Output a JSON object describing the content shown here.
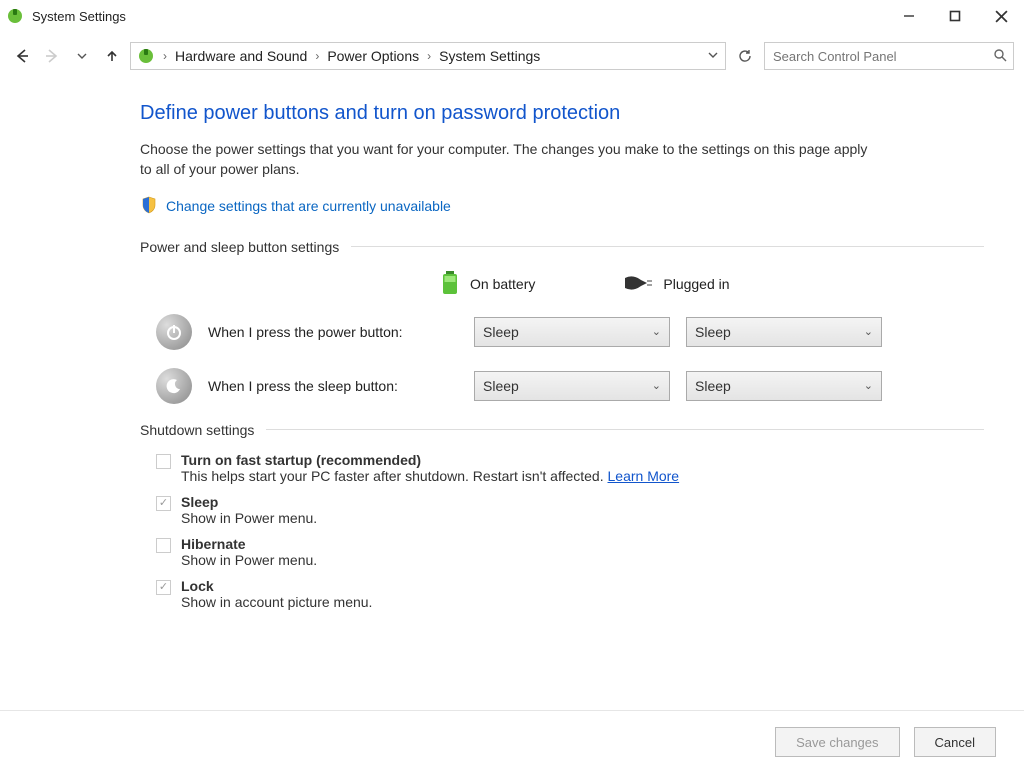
{
  "window": {
    "title": "System Settings"
  },
  "breadcrumb": {
    "item1": "Hardware and Sound",
    "item2": "Power Options",
    "item3": "System Settings"
  },
  "search": {
    "placeholder": "Search Control Panel"
  },
  "page": {
    "headline": "Define power buttons and turn on password protection",
    "desc": "Choose the power settings that you want for your computer. The changes you make to the settings on this page apply to all of your power plans.",
    "change_unavailable": "Change settings that are currently unavailable"
  },
  "group1": {
    "label": "Power and sleep button settings",
    "col_battery": "On battery",
    "col_plugged": "Plugged in",
    "row_power_label": "When I press the power button:",
    "row_sleep_label": "When I press the sleep button:",
    "power_battery_value": "Sleep",
    "power_plugged_value": "Sleep",
    "sleep_battery_value": "Sleep",
    "sleep_plugged_value": "Sleep"
  },
  "group2": {
    "label": "Shutdown settings",
    "fast_startup_label": "Turn on fast startup (recommended)",
    "fast_startup_sub": "This helps start your PC faster after shutdown. Restart isn't affected. ",
    "learn_more": "Learn More",
    "sleep_label": "Sleep",
    "sleep_sub": "Show in Power menu.",
    "hibernate_label": "Hibernate",
    "hibernate_sub": "Show in Power menu.",
    "lock_label": "Lock",
    "lock_sub": "Show in account picture menu."
  },
  "footer": {
    "save": "Save changes",
    "cancel": "Cancel"
  }
}
